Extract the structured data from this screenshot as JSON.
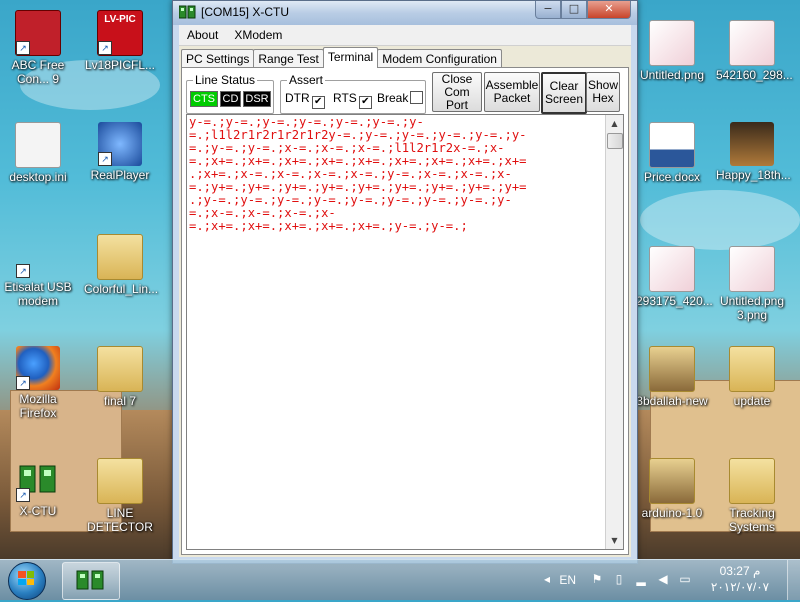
{
  "window": {
    "title": "[COM15] X-CTU",
    "minimize_glyph": "−",
    "maximize_glyph": "□",
    "close_glyph": "✕"
  },
  "menu": [
    "About",
    "XModem"
  ],
  "tabs": [
    "PC Settings",
    "Range Test",
    "Terminal",
    "Modem Configuration"
  ],
  "active_tab": "Terminal",
  "line_status": {
    "label": "Line Status",
    "leds": [
      {
        "label": "CTS",
        "bg": "#00cc00",
        "fg": "#ffffff"
      },
      {
        "label": "CD",
        "bg": "#000000",
        "fg": "#ffffff"
      },
      {
        "label": "DSR",
        "bg": "#000000",
        "fg": "#ffffff"
      }
    ]
  },
  "assert": {
    "label": "Assert",
    "dtr": {
      "label": "DTR",
      "checked": true
    },
    "rts": {
      "label": "RTS",
      "checked": true
    },
    "brk": {
      "label": "Break",
      "checked": false
    }
  },
  "buttons": {
    "close_com": "Close Com Port",
    "assemble": "Assemble Packet",
    "clear": "Clear Screen",
    "show_hex": "Show Hex"
  },
  "terminal": {
    "color": "#e01010",
    "lines": [
      "y-=.;y-=.;y-=.;y-=.;y-=.;y-=.;y-",
      "=.;l1l2r1r2r1r2r1r2y-=.;y-=.;y-=.;y-=.;y-=.;y-",
      "=.;y-=.;y-=.;x-=.;x-=.;x-=.;l1l2r1r2x-=.;x-",
      "=.;x+=.;x+=.;x+=.;x+=.;x+=.;x+=.;x+=.;x+=.;x+=",
      ".;x+=.;x-=.;x-=.;x-=.;x-=.;y-=.;x-=.;x-=.;x-",
      "=.;y+=.;y+=.;y+=.;y+=.;y+=.;y+=.;y+=.;y+=.;y+=",
      ".;y-=.;y-=.;y-=.;y-=.;y-=.;y-=.;y-=.;y-=.;y-",
      "=.;x-=.;x-=.;x-=.;x-",
      "=.;x+=.;x+=.;x+=.;x+=.;x+=.;y-=.;y-=.;"
    ]
  },
  "desktop_icons_left": [
    {
      "name": "desktop-icon-abc-freeconv",
      "label": "ABC Free Con... 9",
      "kind": "app-red"
    },
    {
      "name": "desktop-icon-lv18picfl",
      "label": "Lv18PICFL...",
      "kind": "app-lvpic",
      "badge": "LV-PIC"
    },
    {
      "name": "desktop-icon-desktop-ini",
      "label": "desktop.ini",
      "kind": "file"
    },
    {
      "name": "desktop-icon-realplayer",
      "label": "RealPlayer",
      "kind": "app-real"
    },
    {
      "name": "desktop-icon-etisalat",
      "label": "Etisalat USB modem",
      "kind": "app-etisalat"
    },
    {
      "name": "desktop-icon-colorful-lines",
      "label": "Colorful_Lin...",
      "kind": "folder"
    },
    {
      "name": "desktop-icon-firefox",
      "label": "Mozilla Firefox",
      "kind": "app-firefox"
    },
    {
      "name": "desktop-icon-final7",
      "label": "final 7",
      "kind": "folder"
    },
    {
      "name": "desktop-icon-xctu",
      "label": "X-CTU",
      "kind": "app-xctu"
    },
    {
      "name": "desktop-icon-line-detector",
      "label": "LINE DETECTOR",
      "kind": "folder"
    }
  ],
  "desktop_icons_right": [
    {
      "name": "desktop-icon-untitled-png",
      "label": "Untitled.png",
      "kind": "image"
    },
    {
      "name": "desktop-icon-542160",
      "label": "542160_298...",
      "kind": "image"
    },
    {
      "name": "desktop-icon-price-docx",
      "label": "Price.docx",
      "kind": "word"
    },
    {
      "name": "desktop-icon-happy18",
      "label": "Happy_18th...",
      "kind": "photo"
    },
    {
      "name": "desktop-icon-293175",
      "label": "293175_420...",
      "kind": "image"
    },
    {
      "name": "desktop-icon-untitled3",
      "label": "Untitled.png 3.png",
      "kind": "image"
    },
    {
      "name": "desktop-icon-3bdallah",
      "label": "3bdallah-new",
      "kind": "folder-dark"
    },
    {
      "name": "desktop-icon-update",
      "label": "update",
      "kind": "folder"
    },
    {
      "name": "desktop-icon-arduino",
      "label": "arduino-1.0",
      "kind": "folder-dark"
    },
    {
      "name": "desktop-icon-tracking",
      "label": "Tracking Systems",
      "kind": "folder"
    }
  ],
  "taskbar": {
    "lang": "EN",
    "time": "03:27 م",
    "date": "٢٠١٢/٠٧/٠٧"
  }
}
